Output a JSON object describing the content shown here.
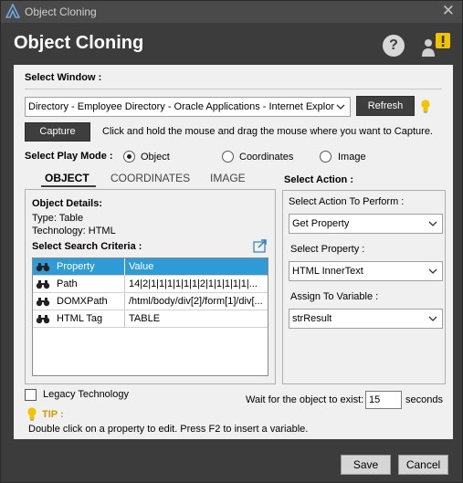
{
  "titlebar": {
    "title": "Object Cloning",
    "close_glyph": "✕"
  },
  "header": {
    "title": "Object Cloning",
    "help_glyph": "?"
  },
  "select_window": {
    "label": "Select Window :",
    "value": "Directory - Employee Directory - Oracle Applications - Internet Explore",
    "refresh_label": "Refresh"
  },
  "capture": {
    "button_label": "Capture",
    "hint": "Click and hold the mouse and drag the mouse where you want to Capture."
  },
  "play_mode": {
    "label": "Select Play Mode :",
    "options": [
      "Object",
      "Coordinates",
      "Image"
    ],
    "selected": "Object"
  },
  "tabs": [
    "OBJECT",
    "COORDINATES",
    "IMAGE"
  ],
  "object_details": {
    "heading": "Object Details:",
    "type_line": "Type:   Table",
    "tech_line": "Technology:   HTML"
  },
  "search_criteria": {
    "label": "Select Search Criteria :",
    "columns": [
      "Property",
      "Value"
    ],
    "rows": [
      {
        "property": "Path",
        "value": "14|2|1|1|1|1|1|1|2|1|1|1|1|1|..."
      },
      {
        "property": "DOMXPath",
        "value": "/html/body/div[2]/form[1]/div[..."
      },
      {
        "property": "HTML Tag",
        "value": "TABLE"
      }
    ]
  },
  "action": {
    "label": "Select Action :",
    "perform_label": "Select Action To Perform :",
    "perform_value": "Get Property",
    "property_label": "Select Property :",
    "property_value": "HTML InnerText",
    "assign_label": "Assign To Variable :",
    "assign_value": "strResult"
  },
  "legacy": {
    "label": "Legacy Technology",
    "checked": false
  },
  "wait": {
    "label": "Wait for the object to exist:",
    "value": "15",
    "unit": "seconds"
  },
  "tip": {
    "label": "TIP :",
    "text": "Double click on a property to edit. Press F2 to insert a variable."
  },
  "footer": {
    "save_label": "Save",
    "cancel_label": "Cancel"
  },
  "colors": {
    "accent": "#2f9bd6",
    "bulb": "#f2c400",
    "dark": "#3c3c3c"
  }
}
